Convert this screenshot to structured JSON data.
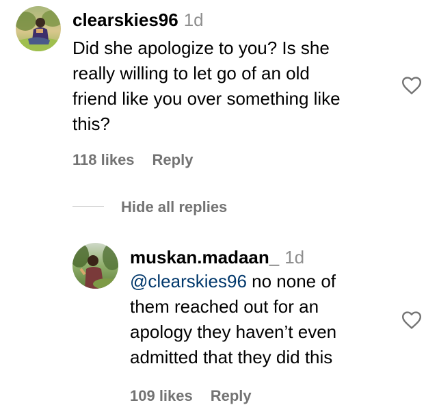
{
  "comments": [
    {
      "username": "clearskies96",
      "time": "1d",
      "text_lines": [
        "Did she apologize to you? Is she",
        "really willing to let go of an old",
        "friend like you over something like",
        "this?"
      ],
      "likes": "118 likes",
      "reply_label": "Reply",
      "heart_icon": "heart-outline-icon"
    }
  ],
  "replies_toggle": {
    "label": "Hide all replies"
  },
  "replies": [
    {
      "username": "muskan.madaan_",
      "time": "1d",
      "mention": "@clearskies96",
      "first_line_rest": " no none of",
      "text_lines": [
        "them reached out for an",
        "apology they haven’t even",
        "admitted that they did this"
      ],
      "likes": "109 likes",
      "reply_label": "Reply",
      "heart_icon": "heart-outline-icon"
    }
  ],
  "colors": {
    "text": "#000000",
    "muted": "#737373",
    "timestamp": "#8e8e8e",
    "mention": "#00376b",
    "divider": "#c7c7c7"
  }
}
